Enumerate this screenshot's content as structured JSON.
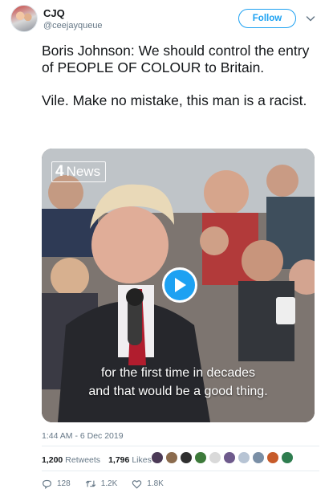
{
  "user": {
    "display_name": "CJQ",
    "handle": "@ceejayqueue",
    "avatar_icon": "profile-photo"
  },
  "follow_label": "Follow",
  "tweet": {
    "line1": "Boris Johnson: We should control the entry of PEOPLE OF COLOUR to Britain.",
    "line2": " Vile. Make no mistake, this man is a racist."
  },
  "video": {
    "logo_mark": "4",
    "logo_text": "News",
    "caption_line1": "for the first time in decades",
    "caption_line2": "and that would be a good thing.",
    "play_icon": "play-icon"
  },
  "timestamp": "1:44 AM - 6 Dec 2019",
  "stats": {
    "retweets_count": "1,200",
    "retweets_label": "Retweets",
    "likes_count": "1,796",
    "likes_label": "Likes"
  },
  "liker_colors": [
    "#4b3a56",
    "#8b6b4d",
    "#2f2f2f",
    "#3d7a3a",
    "#d9d9d9",
    "#6e5a8c",
    "#b7c4d4",
    "#7a8fa6",
    "#c75b2a",
    "#2e7d4f"
  ],
  "actions": {
    "reply_count": "128",
    "retweet_count": "1.2K",
    "like_count": "1.8K"
  },
  "colors": {
    "accent": "#1da1f2",
    "text_secondary": "#657786"
  }
}
